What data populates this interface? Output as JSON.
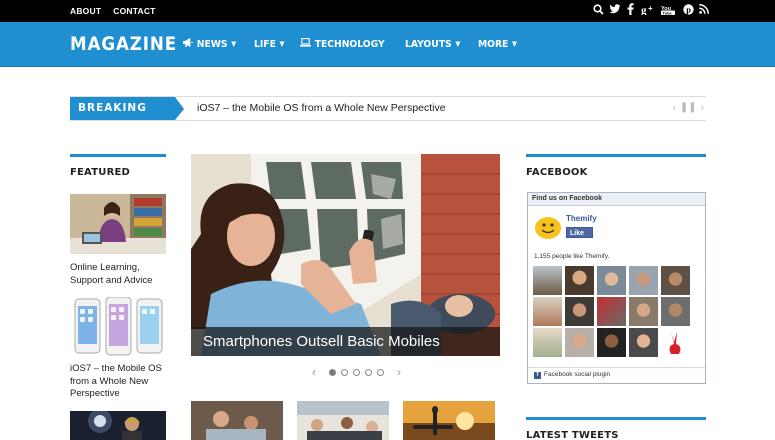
{
  "topbar": {
    "links": [
      "ABOUT",
      "CONTACT"
    ],
    "social_icons": [
      "search-icon",
      "twitter-icon",
      "facebook-icon",
      "google-plus-icon",
      "youtube-icon",
      "pinterest-icon",
      "rss-icon"
    ]
  },
  "header": {
    "logo": "MAGAZINE",
    "nav": [
      {
        "label": "NEWS",
        "icon": "megaphone-icon",
        "dropdown": true
      },
      {
        "label": "LIFE",
        "dropdown": true
      },
      {
        "label": "TECHNOLOGY",
        "icon": "laptop-icon",
        "dropdown": false
      },
      {
        "label": "LAYOUTS",
        "dropdown": true
      },
      {
        "label": "MORE",
        "dropdown": true
      }
    ]
  },
  "breaking": {
    "label": "BREAKING NEWS",
    "headline": "iOS7 – the Mobile OS from a Whole New Perspective"
  },
  "featured": {
    "title": "FEATURED",
    "items": [
      {
        "caption": "Online Learning, Support and Advice"
      },
      {
        "caption": "iOS7 – the Mobile OS from a Whole New Perspective"
      },
      {
        "caption": ""
      }
    ]
  },
  "slider": {
    "caption": "Smartphones Outsell Basic Mobiles",
    "dots": 5,
    "active": 0
  },
  "facebook": {
    "title": "FACEBOOK",
    "find_us": "Find us on Facebook",
    "page_name": "Themify",
    "like_label": "Like",
    "count_text": "1,155 people like Themify.",
    "plugin_text": "Facebook social plugin"
  },
  "tweets": {
    "title": "LATEST TWEETS"
  },
  "colors": {
    "accent": "#1f8fd1",
    "topbar": "#000000",
    "facebook": "#3b5998"
  }
}
